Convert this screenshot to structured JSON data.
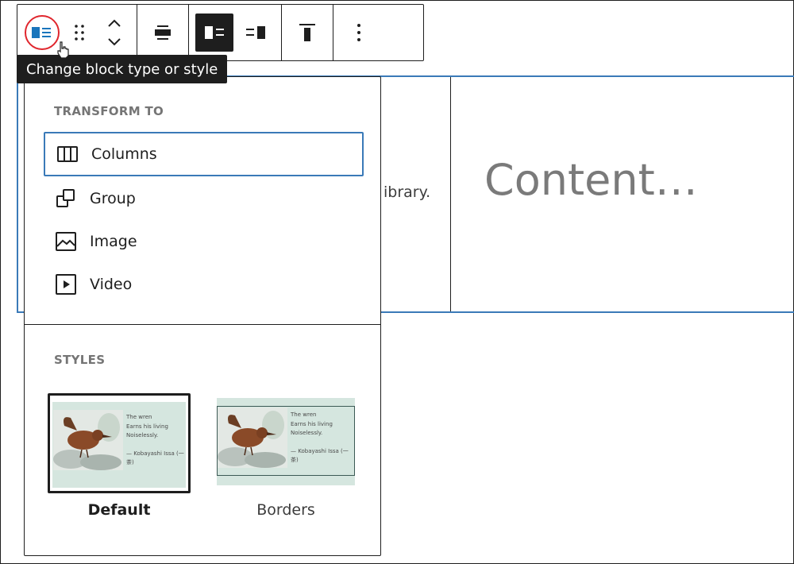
{
  "tooltip": {
    "text": "Change block type or style"
  },
  "toolbar": {
    "buttons": [
      {
        "name": "block-type",
        "icon": "media-text-icon",
        "highlighted": true
      },
      {
        "name": "drag",
        "icon": "drag-handle-icon"
      },
      {
        "name": "move",
        "icon": "chevron-up-down-icon"
      },
      {
        "name": "align",
        "icon": "align-center-icon"
      },
      {
        "name": "media-left",
        "icon": "media-left-icon",
        "active": true
      },
      {
        "name": "media-right",
        "icon": "media-right-icon"
      },
      {
        "name": "vertical-align",
        "icon": "align-top-icon"
      },
      {
        "name": "options",
        "icon": "more-vertical-icon"
      }
    ]
  },
  "canvas": {
    "media_text_fragment": "ibrary.",
    "content_placeholder": "Content…"
  },
  "popover": {
    "transform_label": "TRANSFORM TO",
    "transform_items": [
      {
        "label": "Columns",
        "icon": "columns-icon"
      },
      {
        "label": "Group",
        "icon": "group-icon"
      },
      {
        "label": "Image",
        "icon": "image-icon"
      },
      {
        "label": "Video",
        "icon": "video-icon"
      }
    ],
    "styles_label": "STYLES",
    "styles": [
      {
        "caption": "Default",
        "poem": [
          "The wren",
          "Earns his living",
          "Noiselessly.",
          "— Kobayashi Issa (一",
          "茶)"
        ]
      },
      {
        "caption": "Borders",
        "poem": [
          "The wren",
          "Earns his living",
          "Noiselessly.",
          "— Kobayashi Issa (一",
          "茶)"
        ]
      }
    ]
  },
  "colors": {
    "accent": "#3a7ab8",
    "highlight_ring": "#e0262d",
    "dark": "#1e1e1e",
    "preview_bg": "#d5e6df"
  }
}
